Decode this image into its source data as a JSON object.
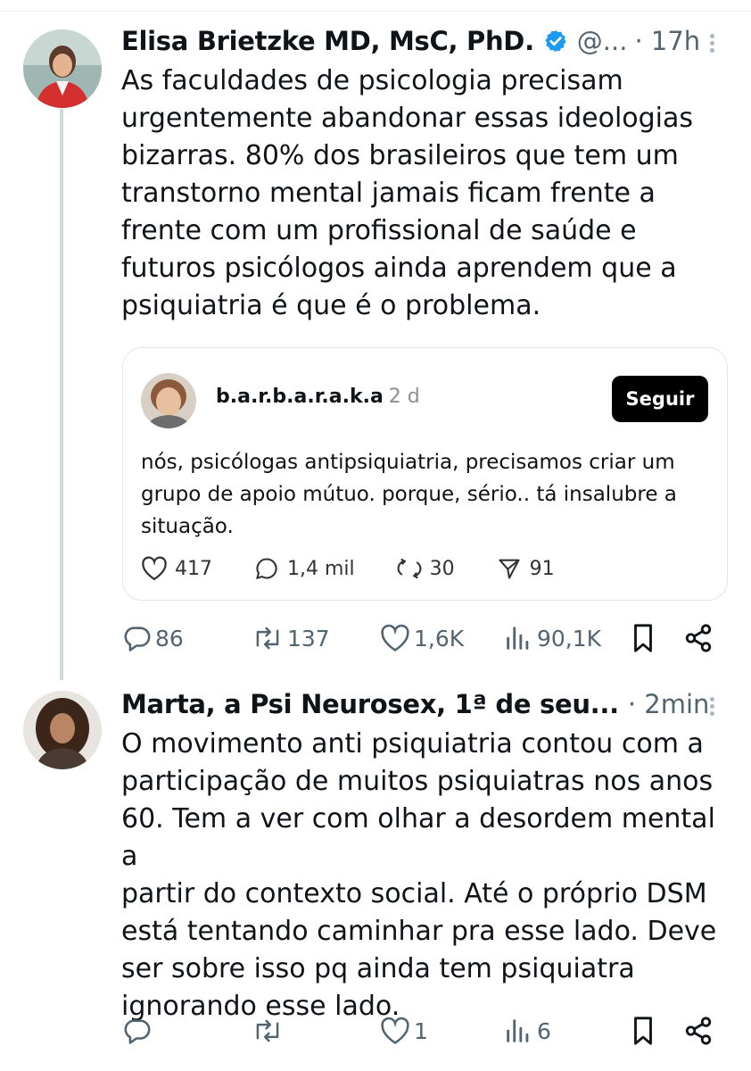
{
  "tweet1": {
    "author": "Elisa Brietzke MD, MsC, PhD.",
    "handle": "@...",
    "time": "· 17h",
    "text_lines": [
      "As faculdades de psicologia precisam",
      "urgentemente abandonar essas ideologias",
      "bizarras. 80% dos brasileiros que tem um",
      "transtorno mental jamais ficam frente a",
      "frente com um profissional de saúde e",
      "futuros psicólogos ainda aprendem que a",
      "psiquiatria é que é o problema."
    ],
    "quote": {
      "username": "b.a.r.b.a.r.a.k.a",
      "time": "2 d",
      "follow_label": "Seguir",
      "text_lines": [
        "nós, psicólogas antipsiquiatria, precisamos criar um",
        "grupo de apoio mútuo. porque, sério.. tá insalubre a",
        "situação."
      ],
      "stats": {
        "likes": "417",
        "comments": "1,4 mil",
        "reposts": "30",
        "shares": "91"
      }
    },
    "actions": {
      "replies": "86",
      "retweets": "137",
      "likes": "1,6K",
      "views": "90,1K"
    }
  },
  "tweet2": {
    "author": "Marta, a Psi Neurosex, 1ª de seu...",
    "time": "· 2min",
    "text_lines": [
      "O movimento anti psiquiatria contou com a",
      "participação de muitos psiquiatras nos anos",
      "60. Tem a ver com olhar a desordem mental a",
      "partir do contexto social. Até o próprio DSM",
      "está tentando caminhar pra esse lado. Deve",
      "ser sobre isso pq ainda tem psiquiatra",
      "ignorando esse lado."
    ],
    "actions": {
      "replies": "",
      "retweets": "",
      "likes": "1",
      "views": "6"
    }
  },
  "colors": {
    "text": "#0f1419",
    "secondary": "#536471",
    "verified": "#1d9bf0",
    "follow_bg": "#000000"
  }
}
